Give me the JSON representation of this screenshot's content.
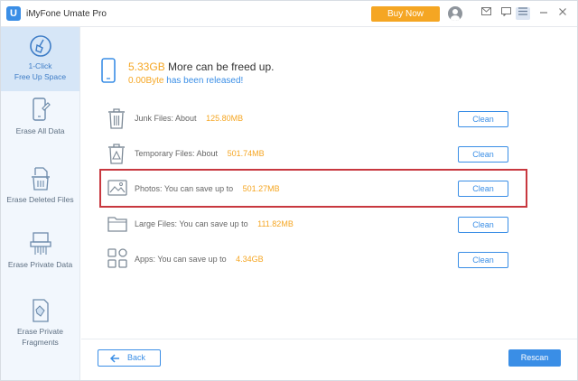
{
  "app": {
    "logo_letter": "U",
    "title": "iMyFone Umate Pro",
    "buy_label": "Buy Now"
  },
  "toolbar_icons": [
    "avatar",
    "mail-icon",
    "chat-icon",
    "menu-icon",
    "minimize-icon",
    "close-icon"
  ],
  "sidebar": {
    "items": [
      {
        "label": "1-Click Free Up Space",
        "line1": "1-Click",
        "line2": "Free Up Space",
        "active": true,
        "icon": "broom-icon"
      },
      {
        "label": "Erase All Data",
        "icon": "phone-erase-icon"
      },
      {
        "label": "Erase Deleted Files",
        "icon": "trash-file-icon"
      },
      {
        "label": "Erase Private Data",
        "icon": "shredder-icon"
      },
      {
        "label": "Erase Private Fragments",
        "line1": "Erase Private",
        "line2": "Fragments",
        "icon": "fragments-icon"
      }
    ]
  },
  "summary": {
    "freeable_size": "5.33GB",
    "freeable_text": "More can be freed up.",
    "released_size": "0.00Byte",
    "released_text": "has been released!"
  },
  "rows": [
    {
      "label": "Junk Files:",
      "prefix": "About",
      "value": "125.80MB",
      "button": "Clean",
      "icon": "trash-icon"
    },
    {
      "label": "Temporary Files:",
      "prefix": "About",
      "value": "501.74MB",
      "button": "Clean",
      "icon": "temp-trash-icon"
    },
    {
      "label": "Photos:",
      "prefix": "You can save up to",
      "value": "501.27MB",
      "button": "Clean",
      "icon": "photo-icon",
      "highlighted": true
    },
    {
      "label": "Large Files:",
      "prefix": "You can save up to",
      "value": "111.82MB",
      "button": "Clean",
      "icon": "folder-icon"
    },
    {
      "label": "Apps:",
      "prefix": "You can save up to",
      "value": "4.34GB",
      "button": "Clean",
      "icon": "apps-icon"
    }
  ],
  "footer": {
    "back_label": "Back",
    "rescan_label": "Rescan"
  },
  "colors": {
    "accent": "#3a8ee6",
    "highlight_value": "#f5a623",
    "selection_outline": "#c8383f",
    "sidebar_bg": "#f2f7fd"
  }
}
